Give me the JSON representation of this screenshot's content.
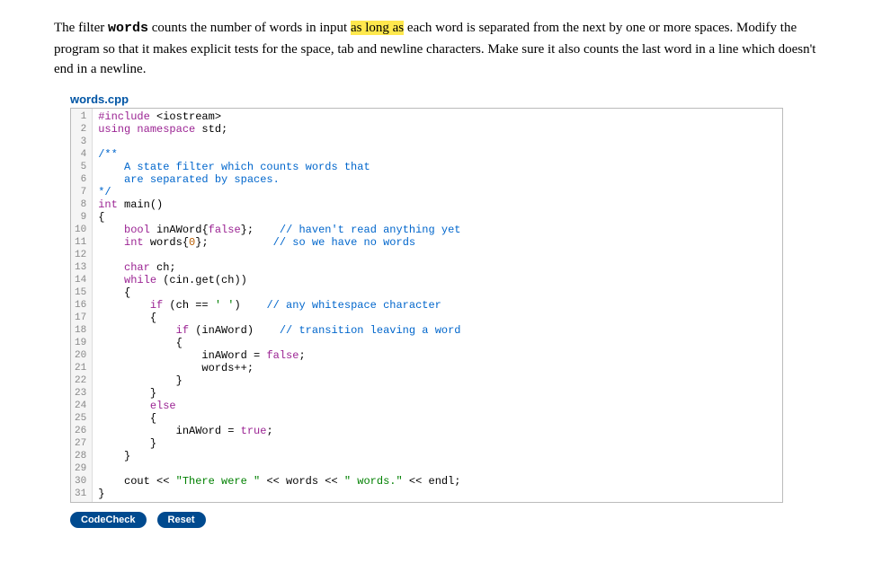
{
  "instructions": {
    "part1": "The filter ",
    "code": "words",
    "part2": " counts the number of words in input ",
    "highlight": "as long as",
    "part3": " each word is separated from the next by one or more spaces. Modify the program so that it makes explicit tests for the space, tab and newline characters. Make sure it also counts the last word in a line which doesn't end in a newline."
  },
  "filename": "words.cpp",
  "code": [
    {
      "n": 1,
      "tokens": [
        [
          "kw-pp",
          "#include"
        ],
        [
          "plain",
          " <iostream>"
        ]
      ]
    },
    {
      "n": 2,
      "tokens": [
        [
          "kw-pp",
          "using"
        ],
        [
          "plain",
          " "
        ],
        [
          "kw-type",
          "namespace"
        ],
        [
          "plain",
          " std;"
        ]
      ]
    },
    {
      "n": 3,
      "tokens": [
        [
          "plain",
          ""
        ]
      ]
    },
    {
      "n": 4,
      "tokens": [
        [
          "comment",
          "/**"
        ]
      ]
    },
    {
      "n": 5,
      "tokens": [
        [
          "comment",
          "    A state filter which counts words that"
        ]
      ]
    },
    {
      "n": 6,
      "tokens": [
        [
          "comment",
          "    are separated by spaces."
        ]
      ]
    },
    {
      "n": 7,
      "tokens": [
        [
          "comment",
          "*/"
        ]
      ]
    },
    {
      "n": 8,
      "tokens": [
        [
          "kw-type",
          "int"
        ],
        [
          "plain",
          " main()"
        ]
      ]
    },
    {
      "n": 9,
      "tokens": [
        [
          "plain",
          "{"
        ]
      ]
    },
    {
      "n": 10,
      "tokens": [
        [
          "plain",
          "    "
        ],
        [
          "kw-type",
          "bool"
        ],
        [
          "plain",
          " inAWord{"
        ],
        [
          "kw-ctrl",
          "false"
        ],
        [
          "plain",
          "};    "
        ],
        [
          "comment",
          "// haven't read anything yet"
        ]
      ]
    },
    {
      "n": 11,
      "tokens": [
        [
          "plain",
          "    "
        ],
        [
          "kw-type",
          "int"
        ],
        [
          "plain",
          " words{"
        ],
        [
          "number",
          "0"
        ],
        [
          "plain",
          "};          "
        ],
        [
          "comment",
          "// so we have no words"
        ]
      ]
    },
    {
      "n": 12,
      "tokens": [
        [
          "plain",
          ""
        ]
      ]
    },
    {
      "n": 13,
      "tokens": [
        [
          "plain",
          "    "
        ],
        [
          "kw-type",
          "char"
        ],
        [
          "plain",
          " ch;"
        ]
      ]
    },
    {
      "n": 14,
      "tokens": [
        [
          "plain",
          "    "
        ],
        [
          "kw-ctrl",
          "while"
        ],
        [
          "plain",
          " (cin.get(ch))"
        ]
      ]
    },
    {
      "n": 15,
      "tokens": [
        [
          "plain",
          "    {"
        ]
      ]
    },
    {
      "n": 16,
      "tokens": [
        [
          "plain",
          "        "
        ],
        [
          "kw-ctrl",
          "if"
        ],
        [
          "plain",
          " (ch == "
        ],
        [
          "string",
          "' '"
        ],
        [
          "plain",
          ")    "
        ],
        [
          "comment",
          "// any whitespace character"
        ]
      ]
    },
    {
      "n": 17,
      "tokens": [
        [
          "plain",
          "        {"
        ]
      ]
    },
    {
      "n": 18,
      "tokens": [
        [
          "plain",
          "            "
        ],
        [
          "kw-ctrl",
          "if"
        ],
        [
          "plain",
          " (inAWord)    "
        ],
        [
          "comment",
          "// transition leaving a word"
        ]
      ]
    },
    {
      "n": 19,
      "tokens": [
        [
          "plain",
          "            {"
        ]
      ]
    },
    {
      "n": 20,
      "tokens": [
        [
          "plain",
          "                inAWord = "
        ],
        [
          "kw-ctrl",
          "false"
        ],
        [
          "plain",
          ";"
        ]
      ]
    },
    {
      "n": 21,
      "tokens": [
        [
          "plain",
          "                words++;"
        ]
      ]
    },
    {
      "n": 22,
      "tokens": [
        [
          "plain",
          "            }"
        ]
      ]
    },
    {
      "n": 23,
      "tokens": [
        [
          "plain",
          "        }"
        ]
      ]
    },
    {
      "n": 24,
      "tokens": [
        [
          "plain",
          "        "
        ],
        [
          "kw-ctrl",
          "else"
        ]
      ]
    },
    {
      "n": 25,
      "tokens": [
        [
          "plain",
          "        {"
        ]
      ]
    },
    {
      "n": 26,
      "tokens": [
        [
          "plain",
          "            inAWord = "
        ],
        [
          "kw-ctrl",
          "true"
        ],
        [
          "plain",
          ";"
        ]
      ]
    },
    {
      "n": 27,
      "tokens": [
        [
          "plain",
          "        }"
        ]
      ]
    },
    {
      "n": 28,
      "tokens": [
        [
          "plain",
          "    }"
        ]
      ]
    },
    {
      "n": 29,
      "tokens": [
        [
          "plain",
          ""
        ]
      ]
    },
    {
      "n": 30,
      "tokens": [
        [
          "plain",
          "    cout << "
        ],
        [
          "string",
          "\"There were \""
        ],
        [
          "plain",
          " << words << "
        ],
        [
          "string",
          "\" words.\""
        ],
        [
          "plain",
          " << endl;"
        ]
      ]
    },
    {
      "n": 31,
      "tokens": [
        [
          "plain",
          "}"
        ]
      ]
    }
  ],
  "buttons": {
    "codecheck": "CodeCheck",
    "reset": "Reset"
  }
}
